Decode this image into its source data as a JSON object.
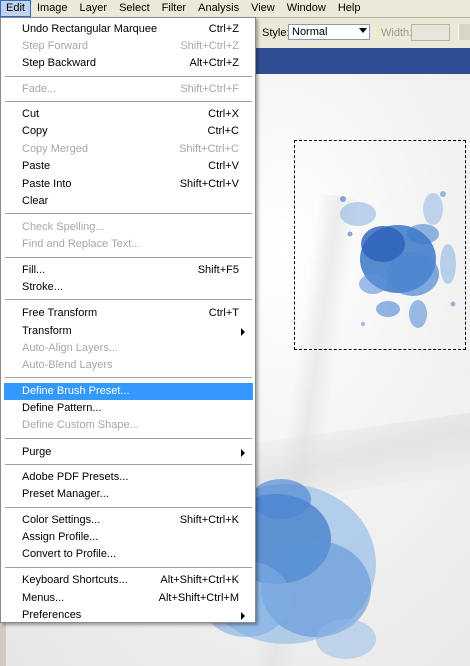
{
  "menubar": {
    "items": [
      "Edit",
      "Image",
      "Layer",
      "Select",
      "Filter",
      "Analysis",
      "View",
      "Window",
      "Help"
    ]
  },
  "options_bar": {
    "style_label": "Style:",
    "style_value": "Normal",
    "width_label": "Width:"
  },
  "edit_menu": {
    "items": [
      {
        "label": "Undo Rectangular Marquee",
        "shortcut": "Ctrl+Z",
        "enabled": true
      },
      {
        "label": "Step Forward",
        "shortcut": "Shift+Ctrl+Z",
        "enabled": false
      },
      {
        "label": "Step Backward",
        "shortcut": "Alt+Ctrl+Z",
        "enabled": true
      },
      {
        "label": "Fade...",
        "shortcut": "Shift+Ctrl+F",
        "enabled": false
      },
      {
        "label": "Cut",
        "shortcut": "Ctrl+X",
        "enabled": true
      },
      {
        "label": "Copy",
        "shortcut": "Ctrl+C",
        "enabled": true
      },
      {
        "label": "Copy Merged",
        "shortcut": "Shift+Ctrl+C",
        "enabled": false
      },
      {
        "label": "Paste",
        "shortcut": "Ctrl+V",
        "enabled": true
      },
      {
        "label": "Paste Into",
        "shortcut": "Shift+Ctrl+V",
        "enabled": true
      },
      {
        "label": "Clear",
        "shortcut": "",
        "enabled": true
      },
      {
        "label": "Check Spelling...",
        "shortcut": "",
        "enabled": false
      },
      {
        "label": "Find and Replace Text...",
        "shortcut": "",
        "enabled": false
      },
      {
        "label": "Fill...",
        "shortcut": "Shift+F5",
        "enabled": true
      },
      {
        "label": "Stroke...",
        "shortcut": "",
        "enabled": true
      },
      {
        "label": "Free Transform",
        "shortcut": "Ctrl+T",
        "enabled": true
      },
      {
        "label": "Transform",
        "shortcut": "",
        "enabled": true,
        "submenu": true
      },
      {
        "label": "Auto-Align Layers...",
        "shortcut": "",
        "enabled": false
      },
      {
        "label": "Auto-Blend Layers",
        "shortcut": "",
        "enabled": false
      },
      {
        "label": "Define Brush Preset...",
        "shortcut": "",
        "enabled": true,
        "highlighted": true
      },
      {
        "label": "Define Pattern...",
        "shortcut": "",
        "enabled": true
      },
      {
        "label": "Define Custom Shape...",
        "shortcut": "",
        "enabled": false
      },
      {
        "label": "Purge",
        "shortcut": "",
        "enabled": true,
        "submenu": true
      },
      {
        "label": "Adobe PDF Presets...",
        "shortcut": "",
        "enabled": true
      },
      {
        "label": "Preset Manager...",
        "shortcut": "",
        "enabled": true
      },
      {
        "label": "Color Settings...",
        "shortcut": "Shift+Ctrl+K",
        "enabled": true
      },
      {
        "label": "Assign Profile...",
        "shortcut": "",
        "enabled": true
      },
      {
        "label": "Convert to Profile...",
        "shortcut": "",
        "enabled": true
      },
      {
        "label": "Keyboard Shortcuts...",
        "shortcut": "Alt+Shift+Ctrl+K",
        "enabled": true
      },
      {
        "label": "Menus...",
        "shortcut": "Alt+Shift+Ctrl+M",
        "enabled": true
      },
      {
        "label": "Preferences",
        "shortcut": "",
        "enabled": true,
        "submenu": true
      }
    ]
  },
  "colors": {
    "highlight": "#3399ff",
    "disabled_text": "#a7a6aa",
    "paint_blue": "#3b78c8"
  }
}
